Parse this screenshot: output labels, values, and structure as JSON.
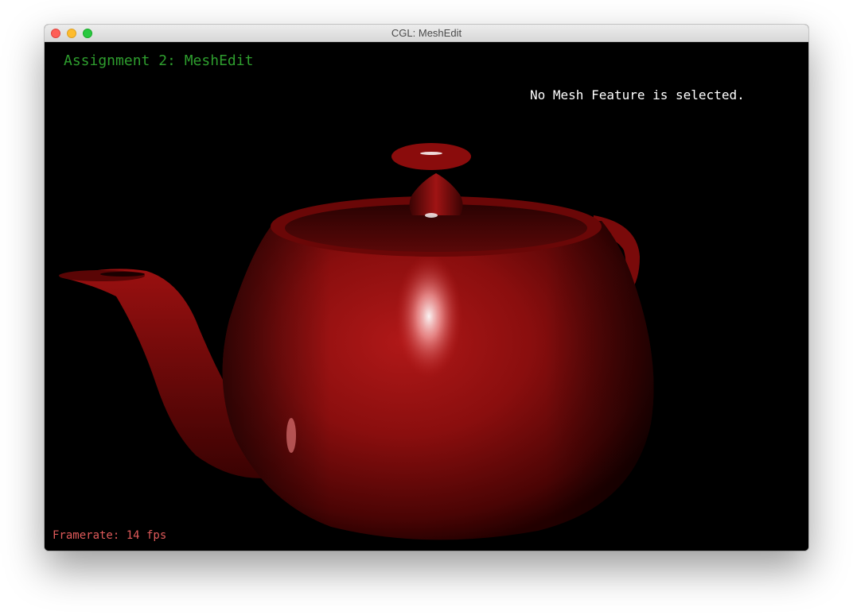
{
  "window": {
    "title": "CGL: MeshEdit"
  },
  "hud": {
    "app_title": "Assignment 2: MeshEdit",
    "status": "No Mesh Feature is selected.",
    "framerate": "Framerate: 14 fps"
  },
  "scene": {
    "object": "teapot",
    "material_color": "#8b0d0d",
    "background_color": "#000000"
  }
}
